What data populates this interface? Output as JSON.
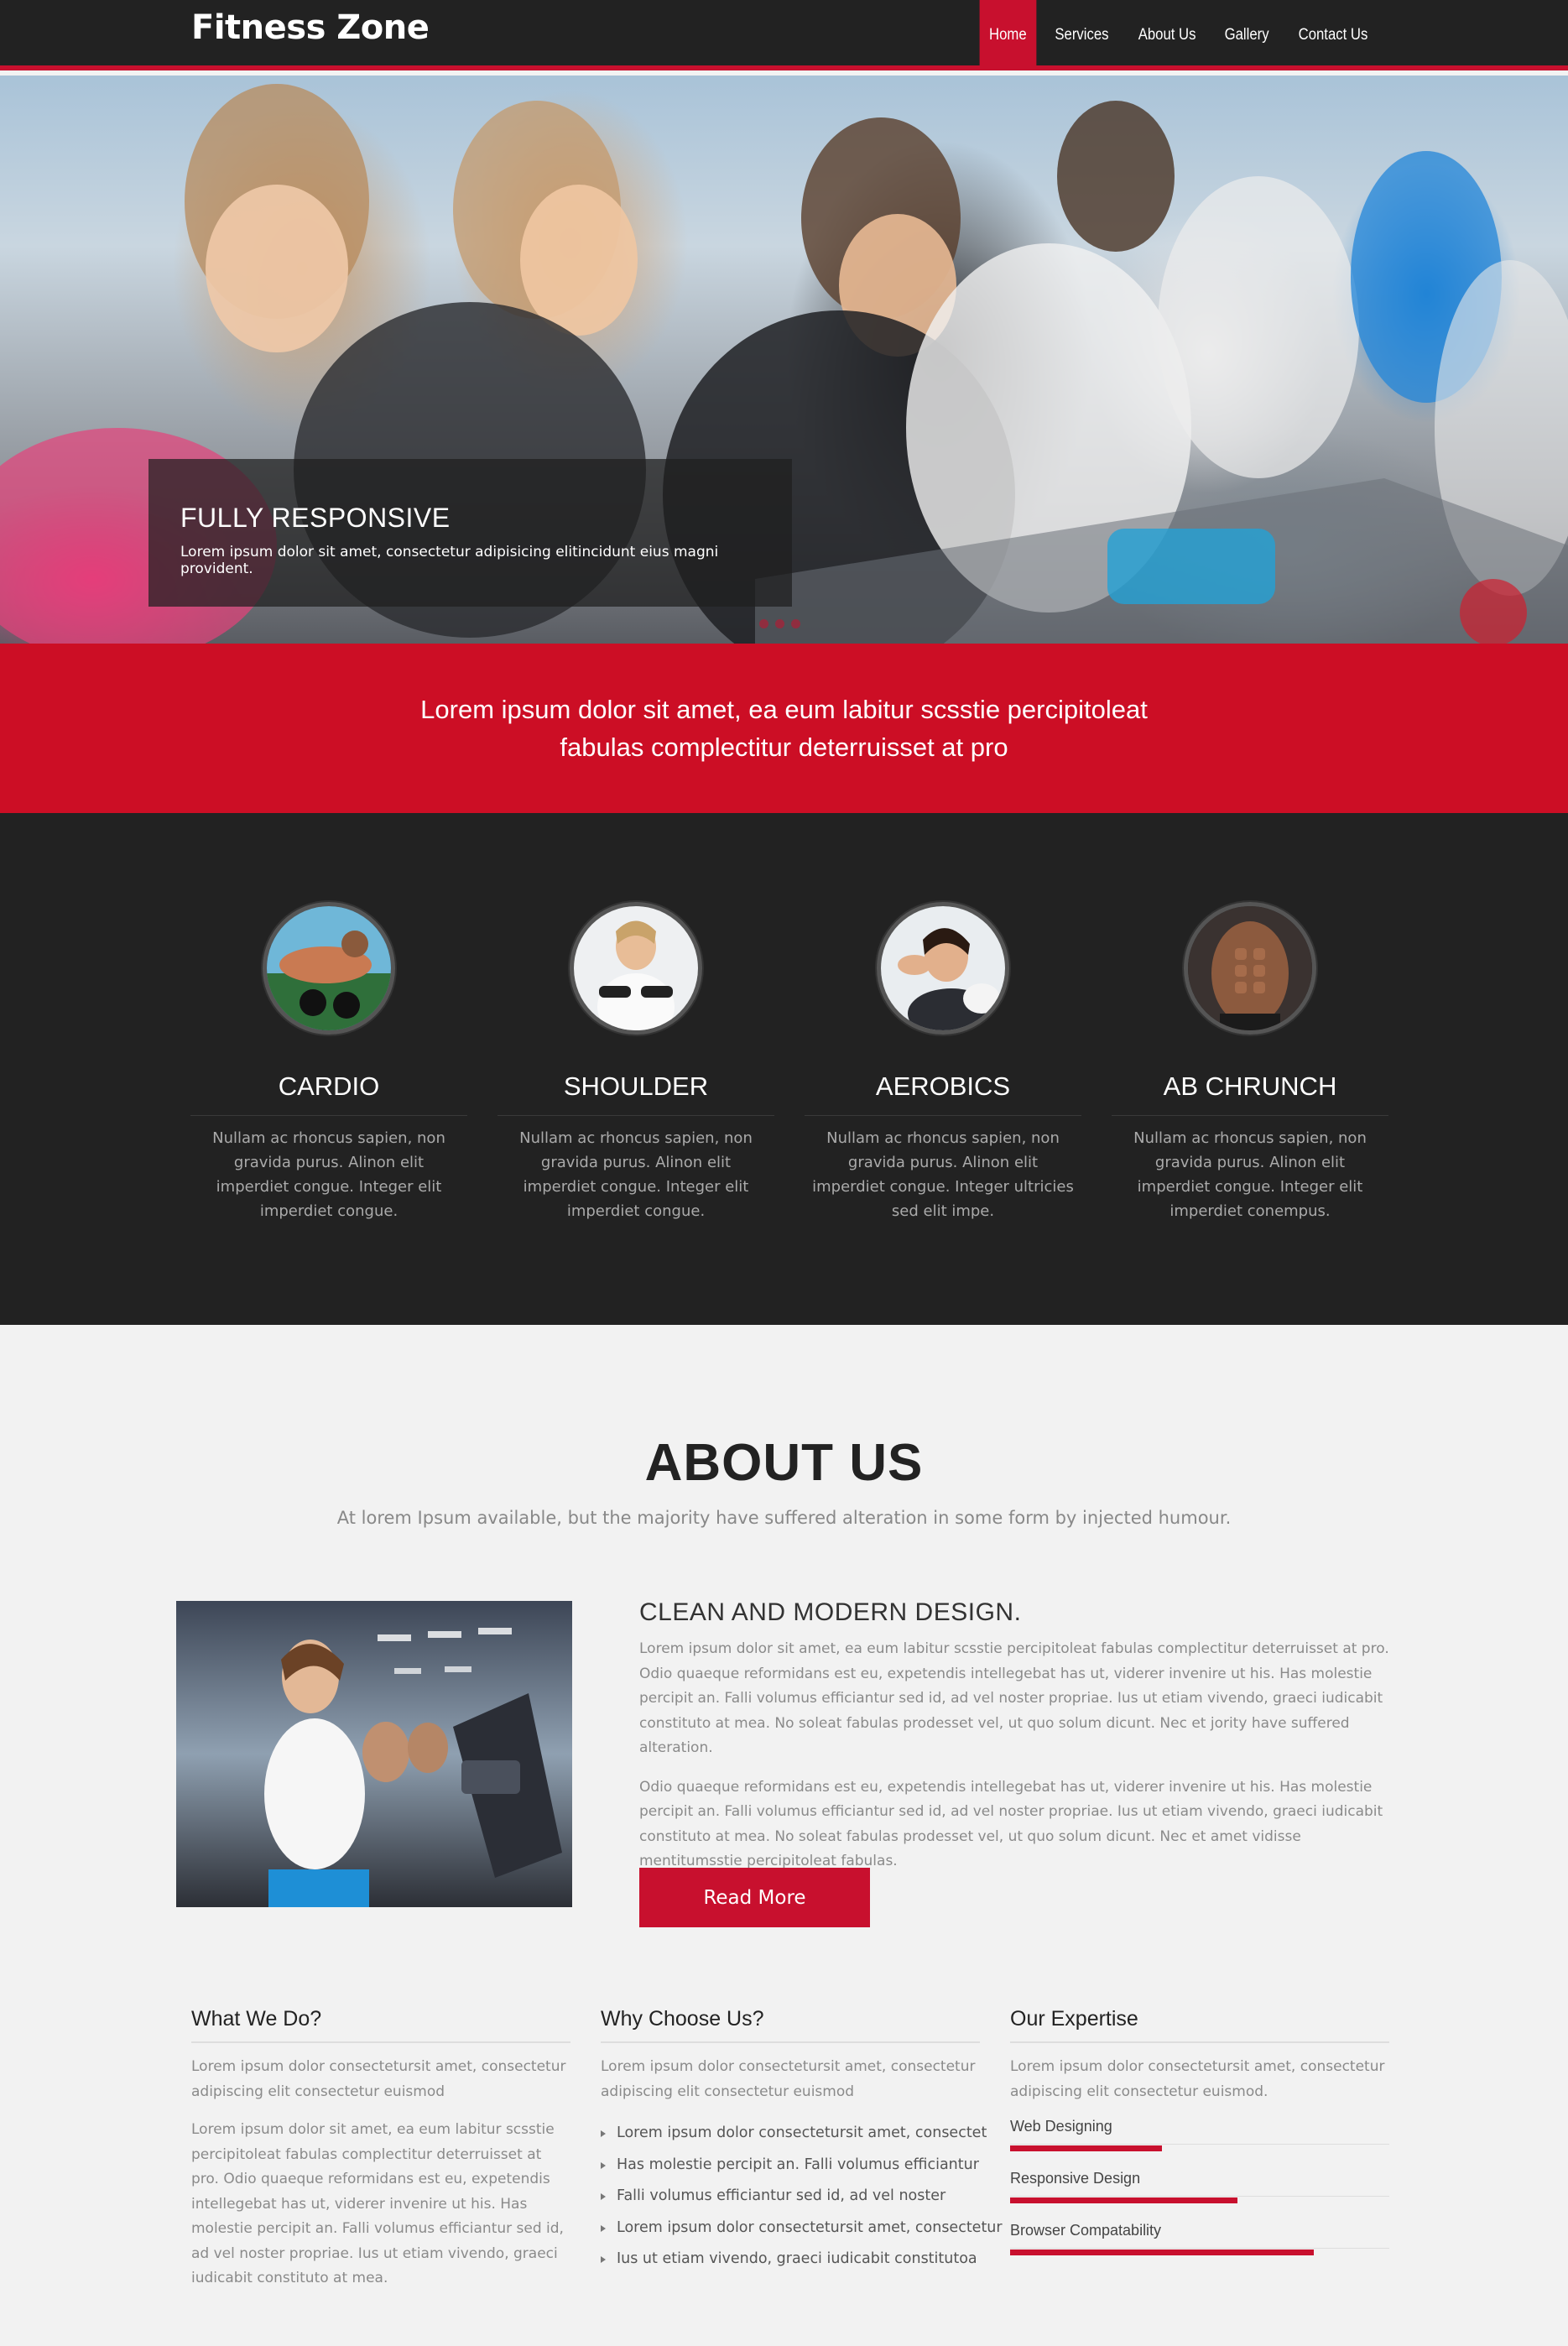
{
  "brand": "Fitness Zone",
  "nav": [
    "Home",
    "Services",
    "About Us",
    "Gallery",
    "Contact Us"
  ],
  "hero": {
    "title": "FULLY RESPONSIVE",
    "text": "Lorem ipsum dolor sit amet, consectetur adipisicing elitincidunt eius magni provident."
  },
  "banner": "Lorem ipsum dolor sit amet, ea eum labitur scsstie percipitoleat fabulas complectitur deterruisset at pro",
  "features": [
    {
      "title": "CARDIO",
      "text": "Nullam ac rhoncus sapien, non gravida purus. Alinon elit imperdiet congue. Integer elit imperdiet congue."
    },
    {
      "title": "SHOULDER",
      "text": "Nullam ac rhoncus sapien, non gravida purus. Alinon elit imperdiet congue. Integer elit imperdiet congue."
    },
    {
      "title": "AEROBICS",
      "text": "Nullam ac rhoncus sapien, non gravida purus. Alinon elit imperdiet congue. Integer ultricies sed elit impe."
    },
    {
      "title": "AB CHRUNCH",
      "text": "Nullam ac rhoncus sapien, non gravida purus. Alinon elit imperdiet congue. Integer elit imperdiet conempus."
    }
  ],
  "about": {
    "title": "ABOUT US",
    "subtitle": "At lorem Ipsum available, but the majority have suffered alteration in some form by injected humour.",
    "heading": "CLEAN AND MODERN DESIGN.",
    "para1": "Lorem ipsum dolor sit amet, ea eum labitur scsstie percipitoleat fabulas complectitur deterruisset at pro. Odio quaeque reformidans est eu, expetendis intellegebat has ut, viderer invenire ut his. Has molestie percipit an. Falli volumus efficiantur sed id, ad vel noster propriae. Ius ut etiam vivendo, graeci iudicabit constituto at mea. No soleat fabulas prodesset vel, ut quo solum dicunt. Nec et jority have suffered alteration.",
    "para2": "Odio quaeque reformidans est eu, expetendis intellegebat has ut, viderer invenire ut his. Has molestie percipit an. Falli volumus efficiantur sed id, ad vel noster propriae. Ius ut etiam vivendo, graeci iudicabit constituto at mea. No soleat fabulas prodesset vel, ut quo solum dicunt. Nec et amet vidisse mentitumsstie percipitoleat fabulas.",
    "button": "Read More"
  },
  "columns": {
    "what": {
      "title": "What We Do?",
      "intro": "Lorem ipsum dolor consectetursit amet, consectetur adipiscing elit consectetur euismod",
      "text": "Lorem ipsum dolor sit amet, ea eum labitur scsstie percipitoleat fabulas complectitur deterruisset at pro. Odio quaeque reformidans est eu, expetendis intellegebat has ut, viderer invenire ut his. Has molestie percipit an. Falli volumus efficiantur sed id, ad vel noster propriae. Ius ut etiam vivendo, graeci iudicabit constituto at mea."
    },
    "why": {
      "title": "Why Choose Us?",
      "intro": "Lorem ipsum dolor consectetursit amet, consectetur adipiscing elit consectetur euismod",
      "items": [
        "Lorem ipsum dolor consectetursit amet, consectet",
        "Has molestie percipit an. Falli volumus efficiantur",
        "Falli volumus efficiantur sed id, ad vel noster",
        "Lorem ipsum dolor consectetursit amet, consectetur",
        "Ius ut etiam vivendo, graeci iudicabit constitutoa"
      ]
    },
    "expertise": {
      "title": "Our Expertise",
      "intro": "Lorem ipsum dolor consectetursit amet, consectetur adipiscing elit consectetur euismod.",
      "skills": [
        {
          "label": "Web Designing",
          "level": 0.4
        },
        {
          "label": "Responsive Design",
          "level": 0.6
        },
        {
          "label": "Browser Compatability",
          "level": 0.8
        }
      ]
    }
  },
  "colors": {
    "accent": "#c8102e",
    "dark": "#222222",
    "light": "#f2f2f2"
  }
}
